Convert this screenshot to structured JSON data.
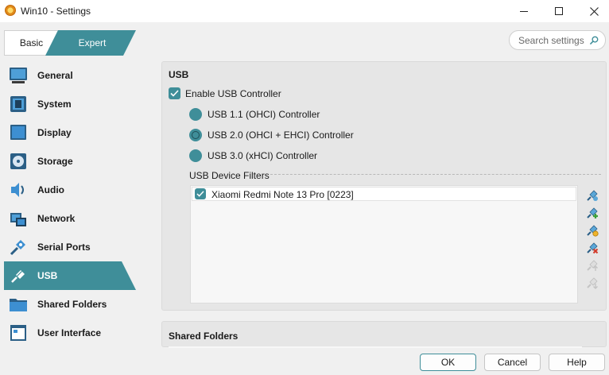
{
  "window": {
    "title": "Win10 - Settings"
  },
  "mode": {
    "basic_label": "Basic",
    "expert_label": "Expert"
  },
  "search": {
    "placeholder": "Search settings"
  },
  "sidebar": {
    "items": [
      {
        "label": "General",
        "icon": "general-icon"
      },
      {
        "label": "System",
        "icon": "system-icon"
      },
      {
        "label": "Display",
        "icon": "display-icon"
      },
      {
        "label": "Storage",
        "icon": "storage-icon"
      },
      {
        "label": "Audio",
        "icon": "audio-icon"
      },
      {
        "label": "Network",
        "icon": "network-icon"
      },
      {
        "label": "Serial Ports",
        "icon": "serial-ports-icon"
      },
      {
        "label": "USB",
        "icon": "usb-icon",
        "active": true
      },
      {
        "label": "Shared Folders",
        "icon": "shared-folders-icon"
      },
      {
        "label": "User Interface",
        "icon": "user-interface-icon"
      }
    ]
  },
  "usb": {
    "title": "USB",
    "enable_label": "Enable USB Controller",
    "enable_checked": true,
    "controllers": [
      {
        "label": "USB 1.1 (OHCI) Controller",
        "selected": false
      },
      {
        "label": "USB 2.0 (OHCI + EHCI) Controller",
        "selected": true
      },
      {
        "label": "USB 3.0 (xHCI) Controller",
        "selected": false
      }
    ],
    "filters_label": "USB Device Filters",
    "filters": [
      {
        "label": "Xiaomi Redmi Note 13 Pro [0223]",
        "checked": true
      }
    ]
  },
  "shared_folders": {
    "title": "Shared Folders"
  },
  "buttons": {
    "ok": "OK",
    "cancel": "Cancel",
    "help": "Help"
  },
  "colors": {
    "accent": "#3f8e99",
    "panel": "#e6e6e6",
    "background": "#f0f0f0"
  }
}
